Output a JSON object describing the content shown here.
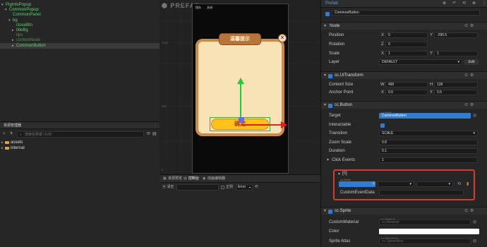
{
  "hierarchy": {
    "items": [
      {
        "label": "PigInfoPopup",
        "depth": 0,
        "arrow": "▾",
        "style": "green"
      },
      {
        "label": "CommonPopup",
        "depth": 1,
        "arrow": "▾",
        "style": "green"
      },
      {
        "label": "CommonPanel",
        "depth": 2,
        "arrow": "",
        "style": "green"
      },
      {
        "label": "bg",
        "depth": 2,
        "arrow": "▾",
        "style": "green"
      },
      {
        "label": "closeBtn",
        "depth": 3,
        "arrow": "",
        "style": "green"
      },
      {
        "label": "titleBg",
        "depth": 3,
        "arrow": "▸",
        "style": "green"
      },
      {
        "label": "tips",
        "depth": 3,
        "arrow": "",
        "style": "dim"
      },
      {
        "label": "contentNode",
        "depth": 3,
        "arrow": "▸",
        "style": "dim"
      },
      {
        "label": "CommonButton",
        "depth": 3,
        "arrow": "▸",
        "style": "selected"
      }
    ]
  },
  "assets": {
    "title": "资源管理器",
    "search_placeholder": "搜索名称或 UUID",
    "items": [
      {
        "label": "assets",
        "icon": "folder-icon",
        "color": "#d9a441"
      },
      {
        "label": "internal",
        "icon": "folder-icon",
        "color": "#d9a441"
      }
    ]
  },
  "scene": {
    "prefab_label": "PREFAB",
    "ruler_1000": "1000",
    "ruler_500": "500",
    "ruler_0": "0",
    "ruler_x0": "0",
    "ruler_x500": "500",
    "game_btn_save": "保存",
    "game_btn_close": "关闭",
    "popup_title": "温馨提示",
    "popup_button": "确定"
  },
  "console": {
    "tabs": [
      "资源预览",
      "控制台",
      "动画编辑器"
    ],
    "toolbar_clear": "清空",
    "regex_label": "正则",
    "level_value": "Error"
  },
  "inspector": {
    "header": "Prefab",
    "node_name": "CommonButton",
    "node_section": "Node",
    "position_label": "Position",
    "position_x": "0",
    "position_y": "-295.5",
    "rotation_label": "Rotation",
    "rotation_z": "0",
    "scale_label": "Scale",
    "scale_x": "1",
    "scale_y": "1",
    "layer_label": "Layer",
    "layer_value": "DEFAULT",
    "edit_label": "Edit",
    "uitransform_section": "cc.UITransform",
    "content_size_label": "Content Size",
    "content_w": "490",
    "content_h": "139",
    "anchor_label": "Anchor Point",
    "anchor_x": "0.5",
    "anchor_y": "0.5",
    "button_section": "cc.Button",
    "target_label": "Target",
    "target_tag": "cc.Node",
    "target_value": "CommonButton",
    "interactable_label": "Interactable",
    "transition_label": "Transition",
    "transition_value": "SCALE",
    "zoom_label": "Zoom Scale",
    "zoom_value": "0.8",
    "duration_label": "Duration",
    "duration_value": "0.1",
    "click_events_label": "Click Events",
    "click_events_count": "1",
    "event_index": "[0]",
    "event_node_tag": "cc.Node",
    "custom_event_label": "CustomEventData",
    "sprite_section": "cc.Sprite",
    "custom_material_label": "CustomMaterial",
    "custom_material_tag": "cc.Material",
    "custom_material_value": "cc.Material",
    "color_label": "Color",
    "sprite_atlas_label": "Sprite Atlas",
    "sprite_atlas_tag": "cc.SpriteAtlas",
    "sprite_atlas_value": "cc.SpriteAtlas",
    "x_tag": "X",
    "y_tag": "Y",
    "z_tag": "Z",
    "w_tag": "W",
    "h_tag": "H"
  },
  "colors": {
    "accent": "#2f7dd0",
    "highlight_border": "#d63b2b",
    "node_green": "#5bd46a"
  }
}
